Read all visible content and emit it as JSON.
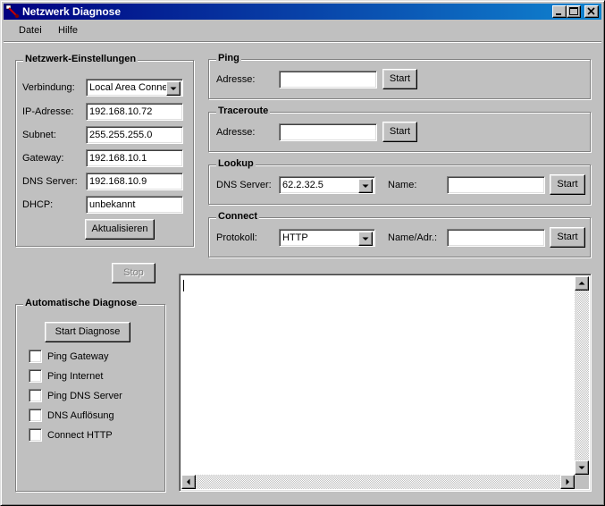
{
  "window": {
    "title": "Netzwerk Diagnose"
  },
  "menu": {
    "file": "Datei",
    "help": "Hilfe"
  },
  "network_settings": {
    "title": "Netzwerk-Einstellungen",
    "connection_label": "Verbindung:",
    "connection_value": "Local Area Connec",
    "ip_label": "IP-Adresse:",
    "ip_value": "192.168.10.72",
    "subnet_label": "Subnet:",
    "subnet_value": "255.255.255.0",
    "gateway_label": "Gateway:",
    "gateway_value": "192.168.10.1",
    "dns_label": "DNS Server:",
    "dns_value": "192.168.10.9",
    "dhcp_label": "DHCP:",
    "dhcp_value": "unbekannt",
    "refresh_button": "Aktualisieren"
  },
  "ping": {
    "title": "Ping",
    "address_label": "Adresse:",
    "address_value": "",
    "start_button": "Start"
  },
  "traceroute": {
    "title": "Traceroute",
    "address_label": "Adresse:",
    "address_value": "",
    "start_button": "Start"
  },
  "lookup": {
    "title": "Lookup",
    "dns_label": "DNS Server:",
    "dns_value": "62.2.32.5",
    "name_label": "Name:",
    "name_value": "",
    "start_button": "Start"
  },
  "connect": {
    "title": "Connect",
    "protocol_label": "Protokoll:",
    "protocol_value": "HTTP",
    "target_label": "Name/Adr.:",
    "target_value": "",
    "start_button": "Start"
  },
  "stop_button": "Stop",
  "auto_diagnosis": {
    "title": "Automatische Diagnose",
    "start_button": "Start Diagnose",
    "checks": [
      {
        "label": "Ping Gateway"
      },
      {
        "label": "Ping Internet"
      },
      {
        "label": "Ping DNS Server"
      },
      {
        "label": "DNS Auflösung"
      },
      {
        "label": "Connect HTTP"
      }
    ]
  },
  "output": {
    "text": ""
  },
  "icons": {
    "app": "network-tool-icon",
    "minimize": "minimize-icon",
    "maximize": "maximize-icon",
    "close": "close-icon",
    "dropdown": "chevron-down-icon"
  },
  "colors": {
    "title_gradient_start": "#000080",
    "title_gradient_end": "#1084d0",
    "face": "#c0c0c0"
  }
}
